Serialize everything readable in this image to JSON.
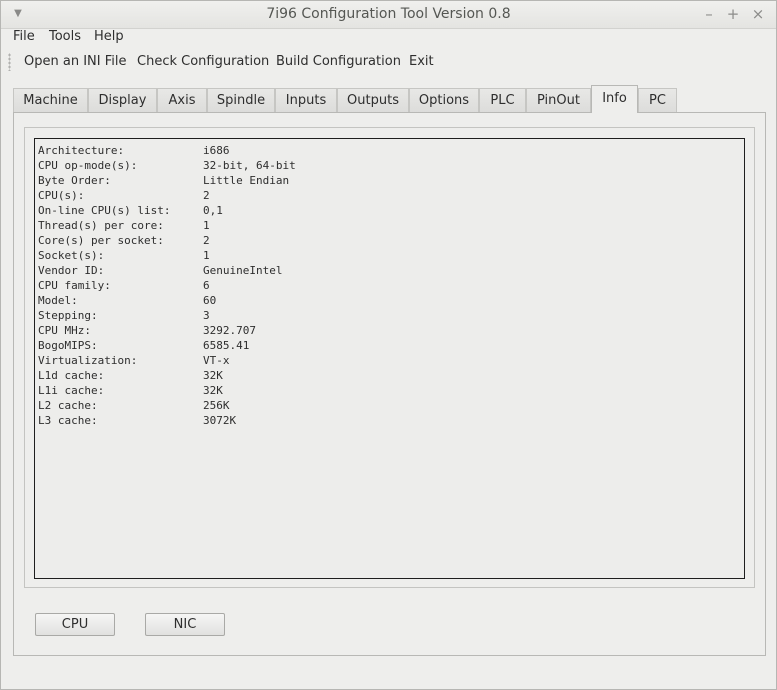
{
  "window": {
    "title": "7i96 Configuration Tool Version 0.8",
    "minimize_glyph": "–",
    "maximize_glyph": "+",
    "close_glyph": "×"
  },
  "menubar": {
    "items": [
      "File",
      "Tools",
      "Help"
    ]
  },
  "toolbar": {
    "items": [
      "Open an INI File",
      "Check Configuration",
      "Build Configuration",
      "Exit"
    ]
  },
  "tabs": {
    "items": [
      "Machine",
      "Display",
      "Axis",
      "Spindle",
      "Inputs",
      "Outputs",
      "Options",
      "PLC",
      "PinOut",
      "Info",
      "PC"
    ],
    "active": "Info"
  },
  "info": {
    "rows": [
      {
        "key": "Architecture:",
        "value": "i686"
      },
      {
        "key": "CPU op-mode(s):",
        "value": "32-bit, 64-bit"
      },
      {
        "key": "Byte Order:",
        "value": "Little Endian"
      },
      {
        "key": "CPU(s):",
        "value": "2"
      },
      {
        "key": "On-line CPU(s) list:",
        "value": "0,1"
      },
      {
        "key": "Thread(s) per core:",
        "value": "1"
      },
      {
        "key": "Core(s) per socket:",
        "value": "2"
      },
      {
        "key": "Socket(s):",
        "value": "1"
      },
      {
        "key": "Vendor ID:",
        "value": "GenuineIntel"
      },
      {
        "key": "CPU family:",
        "value": "6"
      },
      {
        "key": "Model:",
        "value": "60"
      },
      {
        "key": "Stepping:",
        "value": "3"
      },
      {
        "key": "CPU MHz:",
        "value": "3292.707"
      },
      {
        "key": "BogoMIPS:",
        "value": "6585.41"
      },
      {
        "key": "Virtualization:",
        "value": "VT-x"
      },
      {
        "key": "L1d cache:",
        "value": "32K"
      },
      {
        "key": "L1i cache:",
        "value": "32K"
      },
      {
        "key": "L2 cache:",
        "value": "256K"
      },
      {
        "key": "L3 cache:",
        "value": "3072K"
      }
    ]
  },
  "buttons": {
    "cpu_label": "CPU",
    "nic_label": "NIC"
  }
}
